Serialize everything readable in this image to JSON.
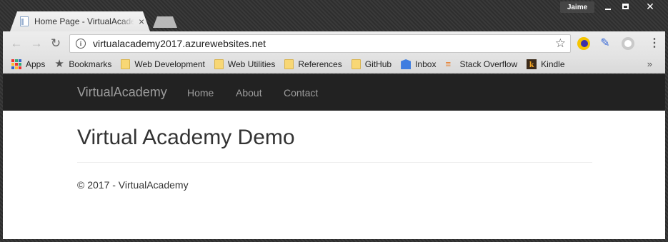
{
  "window": {
    "profile_name": "Jaime"
  },
  "tabs": [
    {
      "title": "Home Page - VirtualAcademy",
      "close": "×"
    }
  ],
  "toolbar": {
    "back_icon": "←",
    "forward_icon": "→",
    "reload_icon": "↻",
    "url": "virtualacademy2017.azurewebsites.net",
    "info_icon": "i",
    "star_icon": "☆",
    "menu_icon": "⋮",
    "dropper_icon": "✎"
  },
  "bookmarks": {
    "items": [
      {
        "label": "Apps",
        "icon": "apps-icon"
      },
      {
        "label": "Bookmarks",
        "icon": "star-icon"
      },
      {
        "label": "Web Development",
        "icon": "folder-icon"
      },
      {
        "label": "Web Utilities",
        "icon": "folder-icon"
      },
      {
        "label": "References",
        "icon": "folder-icon"
      },
      {
        "label": "GitHub",
        "icon": "folder-icon"
      },
      {
        "label": "Inbox",
        "icon": "inbox-icon"
      },
      {
        "label": "Stack Overflow",
        "icon": "stackoverflow-icon"
      },
      {
        "label": "Kindle",
        "icon": "kindle-icon"
      }
    ],
    "more": "»",
    "star_glyph": "★",
    "so_glyph": "≡",
    "kindle_glyph": "k"
  },
  "site": {
    "brand": "VirtualAcademy",
    "nav": [
      "Home",
      "About",
      "Contact"
    ],
    "heading": "Virtual Academy Demo",
    "footer": "© 2017 - VirtualAcademy"
  },
  "colors": {
    "navbar_bg": "#222222",
    "nav_text": "#9d9d9d",
    "body_text": "#333333"
  }
}
